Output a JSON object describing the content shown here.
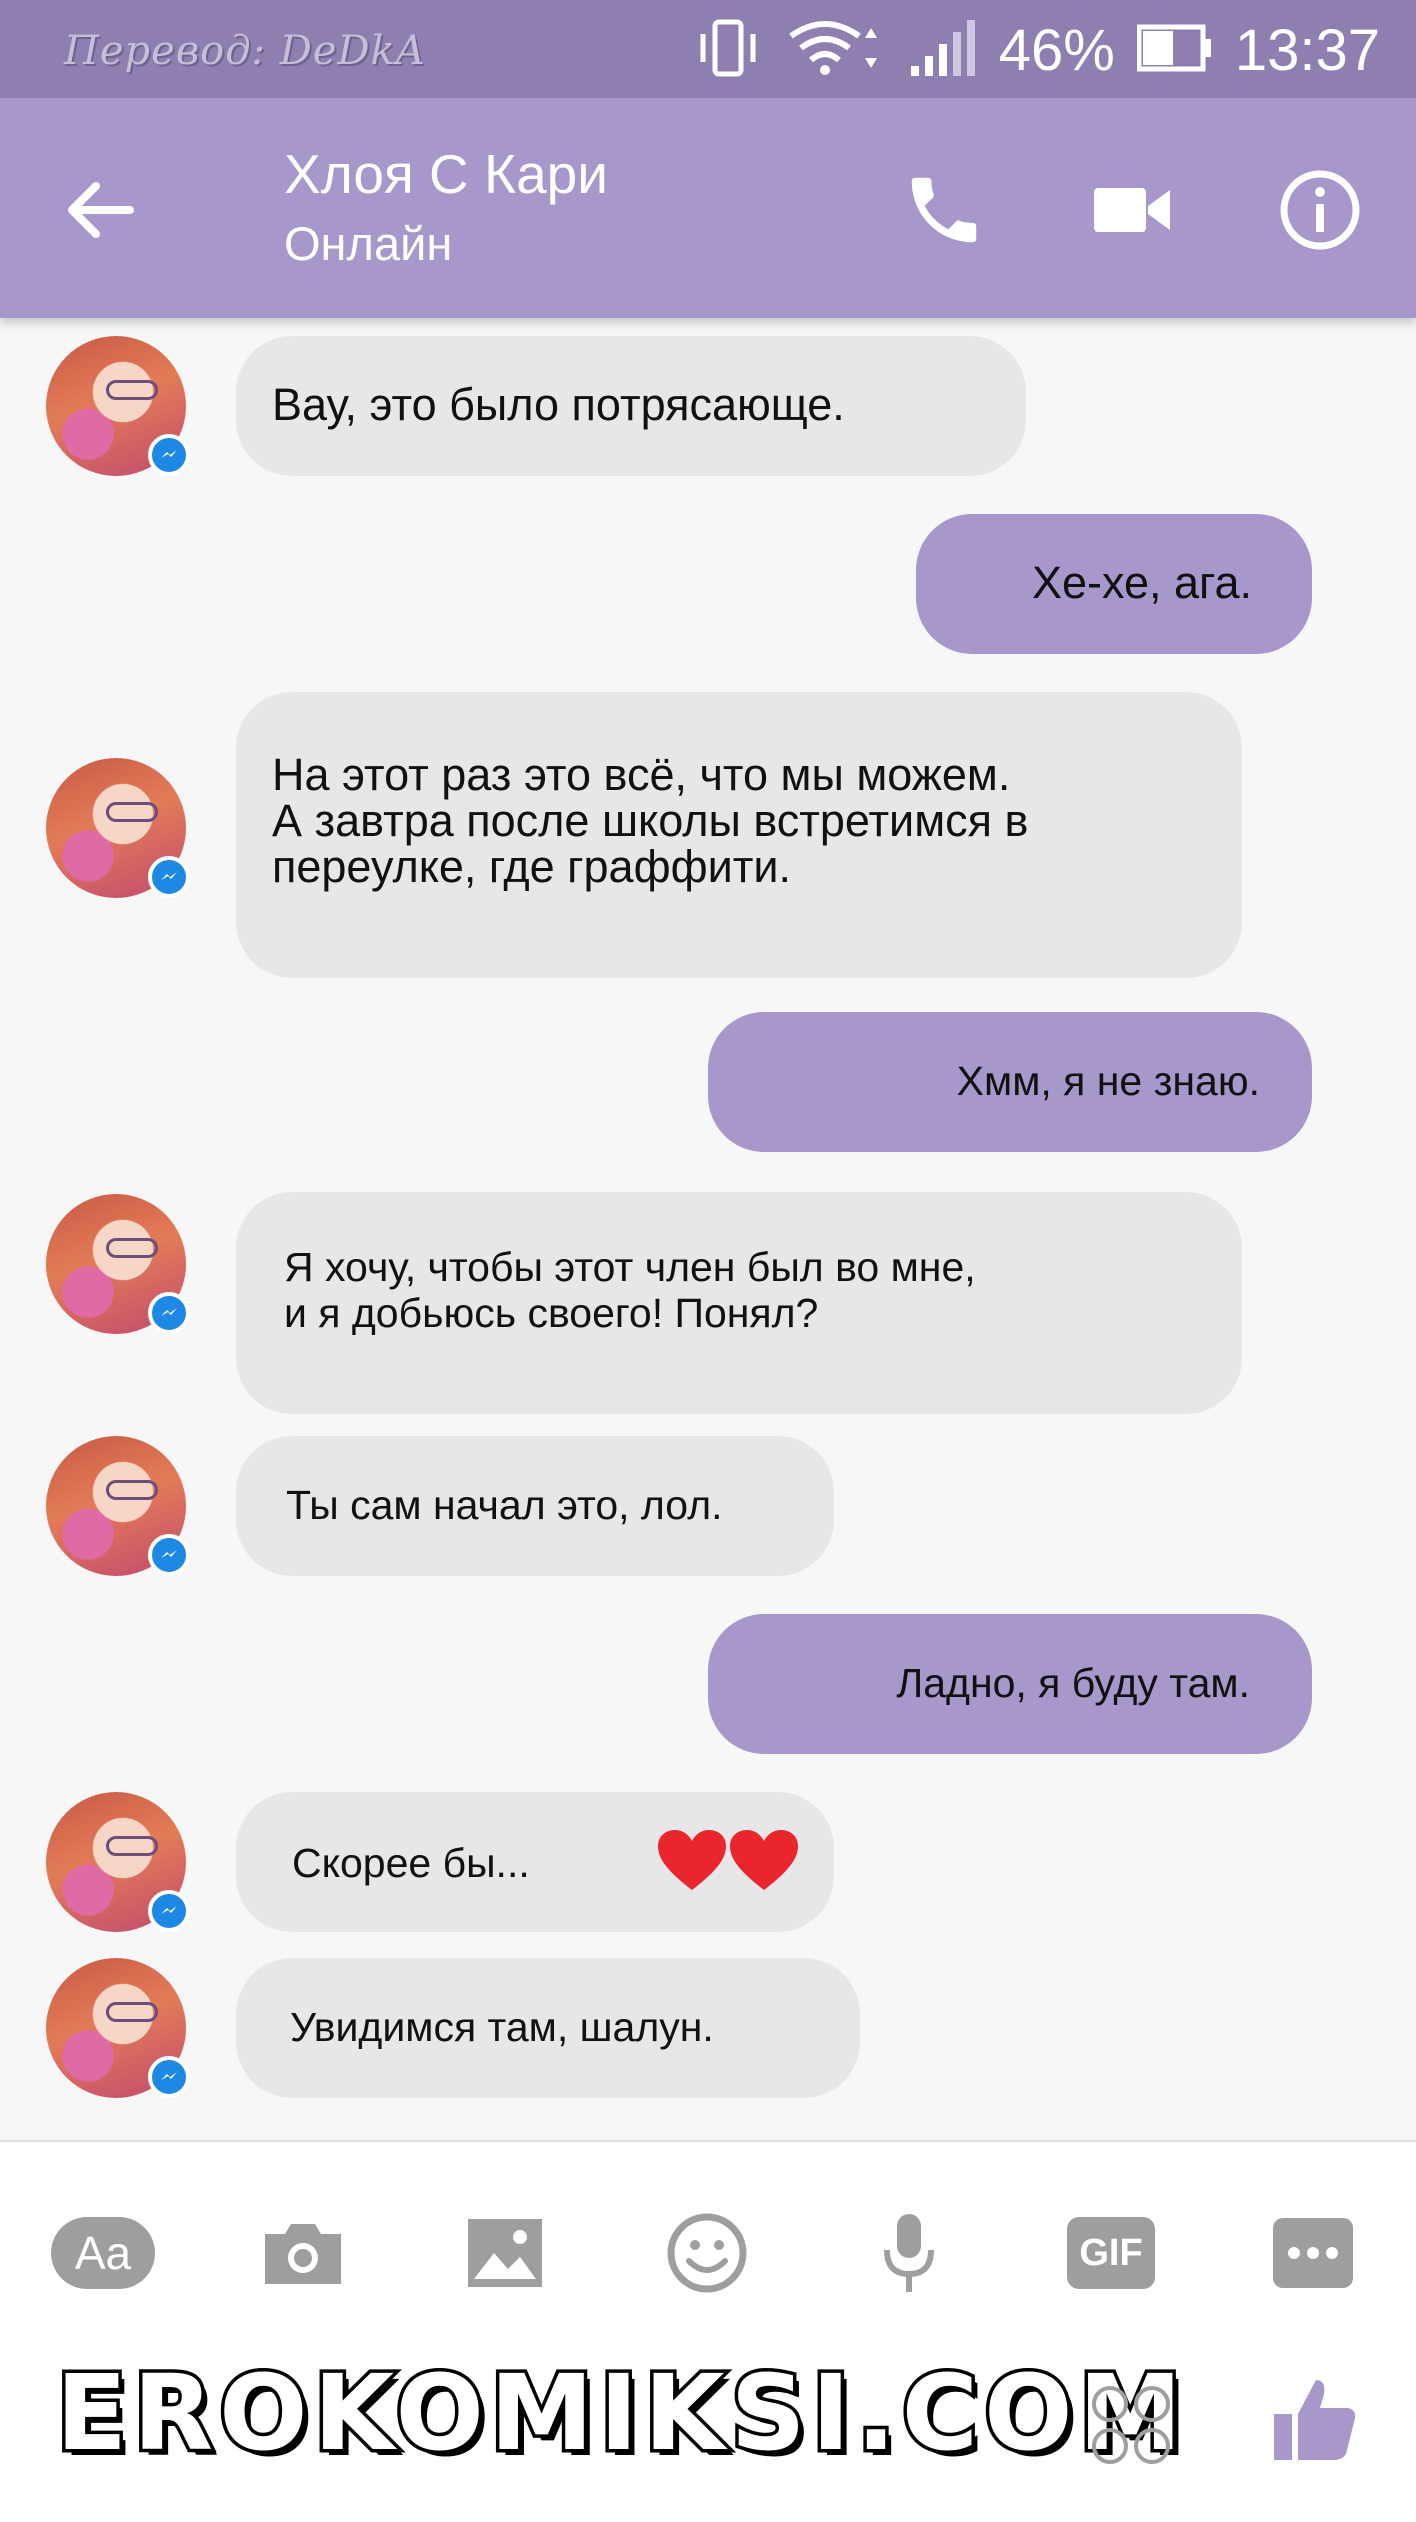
{
  "status_bar": {
    "credit": "Перевод: DeDkA",
    "battery": "46%",
    "time": "13:37"
  },
  "header": {
    "contact_name": "Хлоя С Кари",
    "contact_status": "Онлайн"
  },
  "messages": [
    {
      "side": "in",
      "text": "Вау, это было потрясающе."
    },
    {
      "side": "out",
      "text": "Хе-хе, ага."
    },
    {
      "side": "in",
      "text": "На этот раз это всё, что мы можем.\nА завтра после школы встретимся в\nпереулке, где граффити."
    },
    {
      "side": "out",
      "text": "Хмм, я не знаю."
    },
    {
      "side": "in",
      "text": "Я хочу, чтобы этот член был во мне,\nи я добьюсь своего! Понял?"
    },
    {
      "side": "in",
      "text": "Ты сам начал это, лол."
    },
    {
      "side": "out",
      "text": "Ладно, я буду там."
    },
    {
      "side": "in",
      "text": "Скорее бы..."
    },
    {
      "side": "in",
      "text": "Увидимся там, шалун."
    }
  ],
  "composer": {
    "text_tool_label": "Aa",
    "gif_label": "GIF"
  },
  "watermark": "EROKOMIKSI.COM",
  "colors": {
    "accent": "#a797ca",
    "status_bar": "#8f7fb0",
    "incoming_bubble": "#e7e6e8",
    "messenger_badge": "#1e88e5",
    "heart": "#e8262b"
  }
}
